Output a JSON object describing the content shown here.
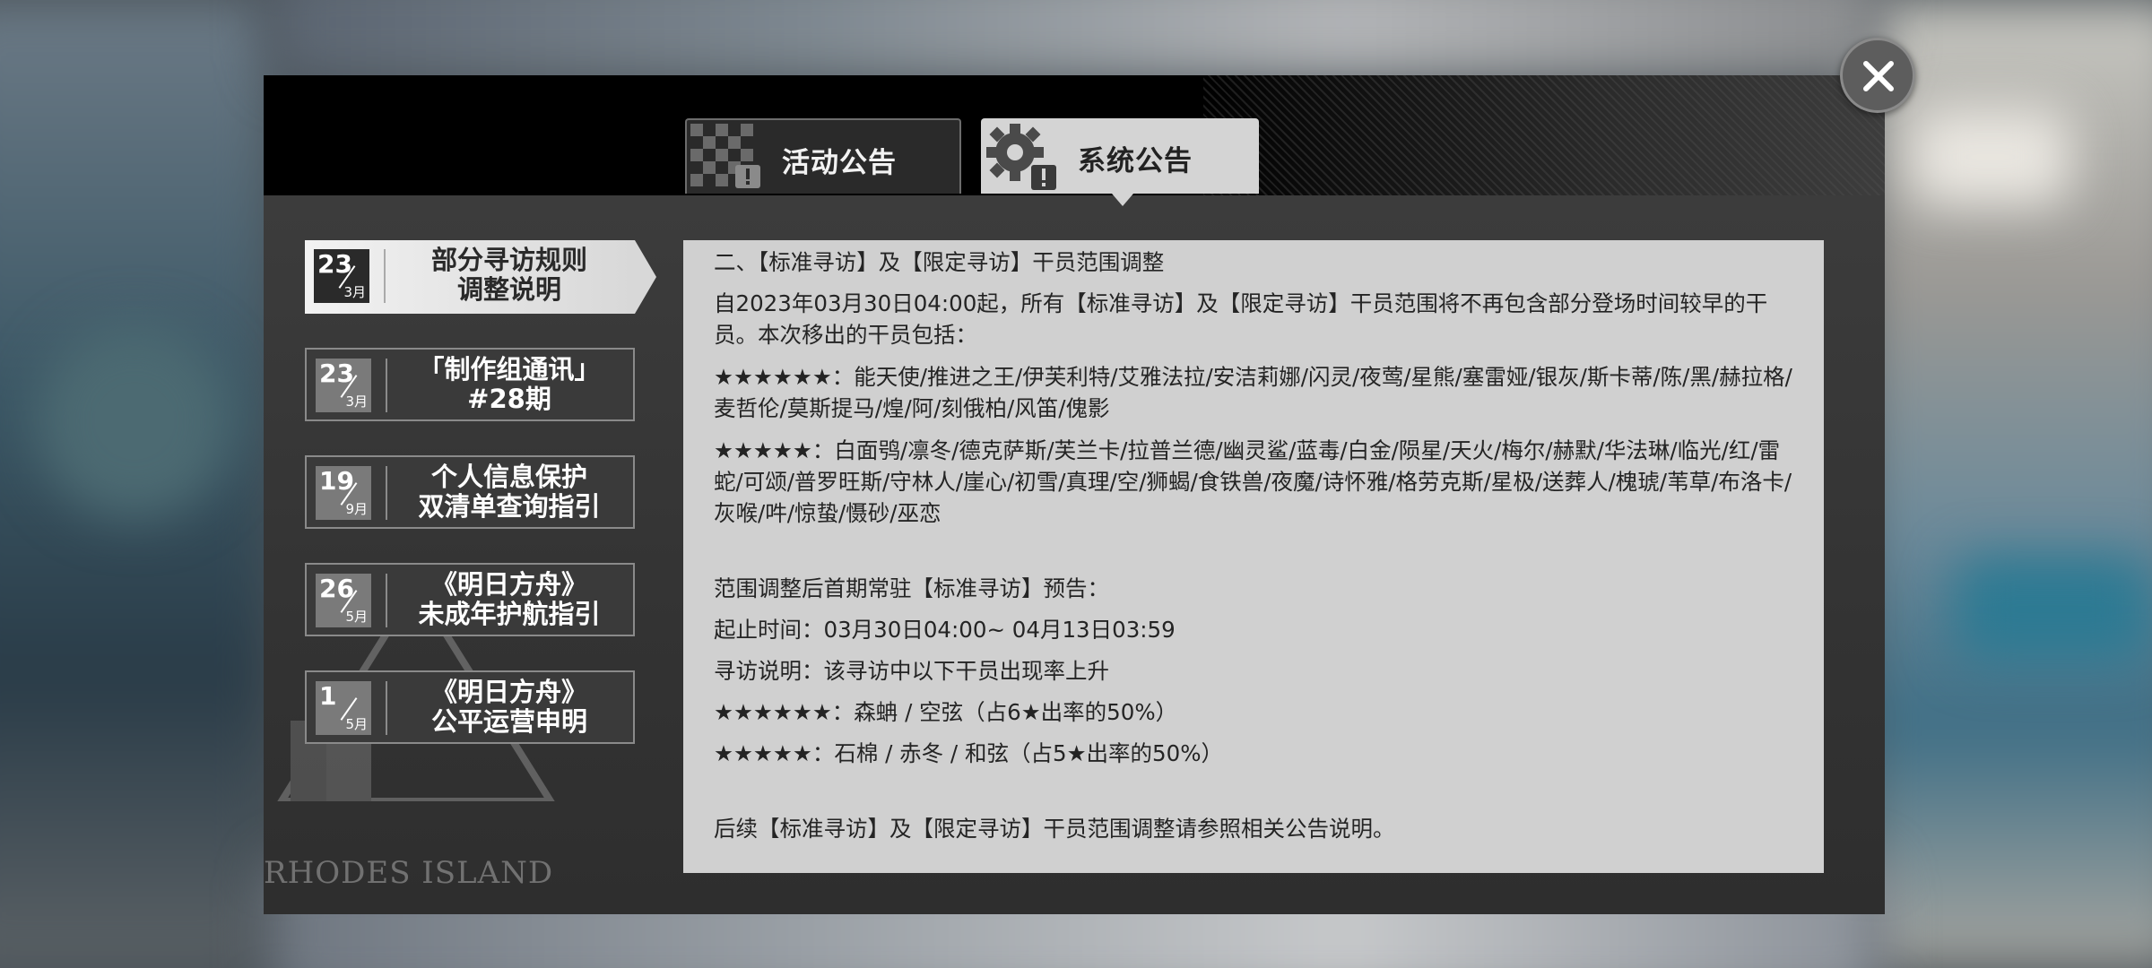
{
  "tabs": {
    "activity": "活动公告",
    "system": "系统公告"
  },
  "watermark": "RHODES ISLAND",
  "notices": [
    {
      "day": "23",
      "month": "3月",
      "title": "部分寻访规则\n调整说明"
    },
    {
      "day": "23",
      "month": "3月",
      "title": "「制作组通讯」\n#28期"
    },
    {
      "day": "19",
      "month": "9月",
      "title": "个人信息保护\n双清单查询指引"
    },
    {
      "day": "26",
      "month": "5月",
      "title": "《明日方舟》\n未成年护航指引"
    },
    {
      "day": "1",
      "month": "5月",
      "title": "《明日方舟》\n公平运营申明"
    }
  ],
  "content": {
    "heading": "二、【标准寻访】及【限定寻访】干员范围调整",
    "intro": "自2023年03月30日04:00起，所有【标准寻访】及【限定寻访】干员范围将不再包含部分登场时间较早的干员。本次移出的干员包括：",
    "six_star": "★★★★★★：能天使/推进之王/伊芙利特/艾雅法拉/安洁莉娜/闪灵/夜莺/星熊/塞雷娅/银灰/斯卡蒂/陈/黑/赫拉格/麦哲伦/莫斯提马/煌/阿/刻俄柏/风笛/傀影",
    "five_star": "★★★★★：白面鸮/凛冬/德克萨斯/芙兰卡/拉普兰德/幽灵鲨/蓝毒/白金/陨星/天火/梅尔/赫默/华法琳/临光/红/雷蛇/可颂/普罗旺斯/守林人/崖心/初雪/真理/空/狮蝎/食铁兽/夜魔/诗怀雅/格劳克斯/星极/送葬人/槐琥/苇草/布洛卡/灰喉/吽/惊蛰/慑砂/巫恋",
    "preview_title": "范围调整后首期常驻【标准寻访】预告：",
    "period": "起止时间：03月30日04:00~ 04月13日03:59",
    "desc": "寻访说明：该寻访中以下干员出现率上升",
    "rate_up_six": "★★★★★★：森蚺 / 空弦（占6★出率的50%）",
    "rate_up_five": "★★★★★：石棉 / 赤冬 / 和弦（占5★出率的50%）",
    "footer": "后续【标准寻访】及【限定寻访】干员范围调整请参照相关公告说明。"
  }
}
